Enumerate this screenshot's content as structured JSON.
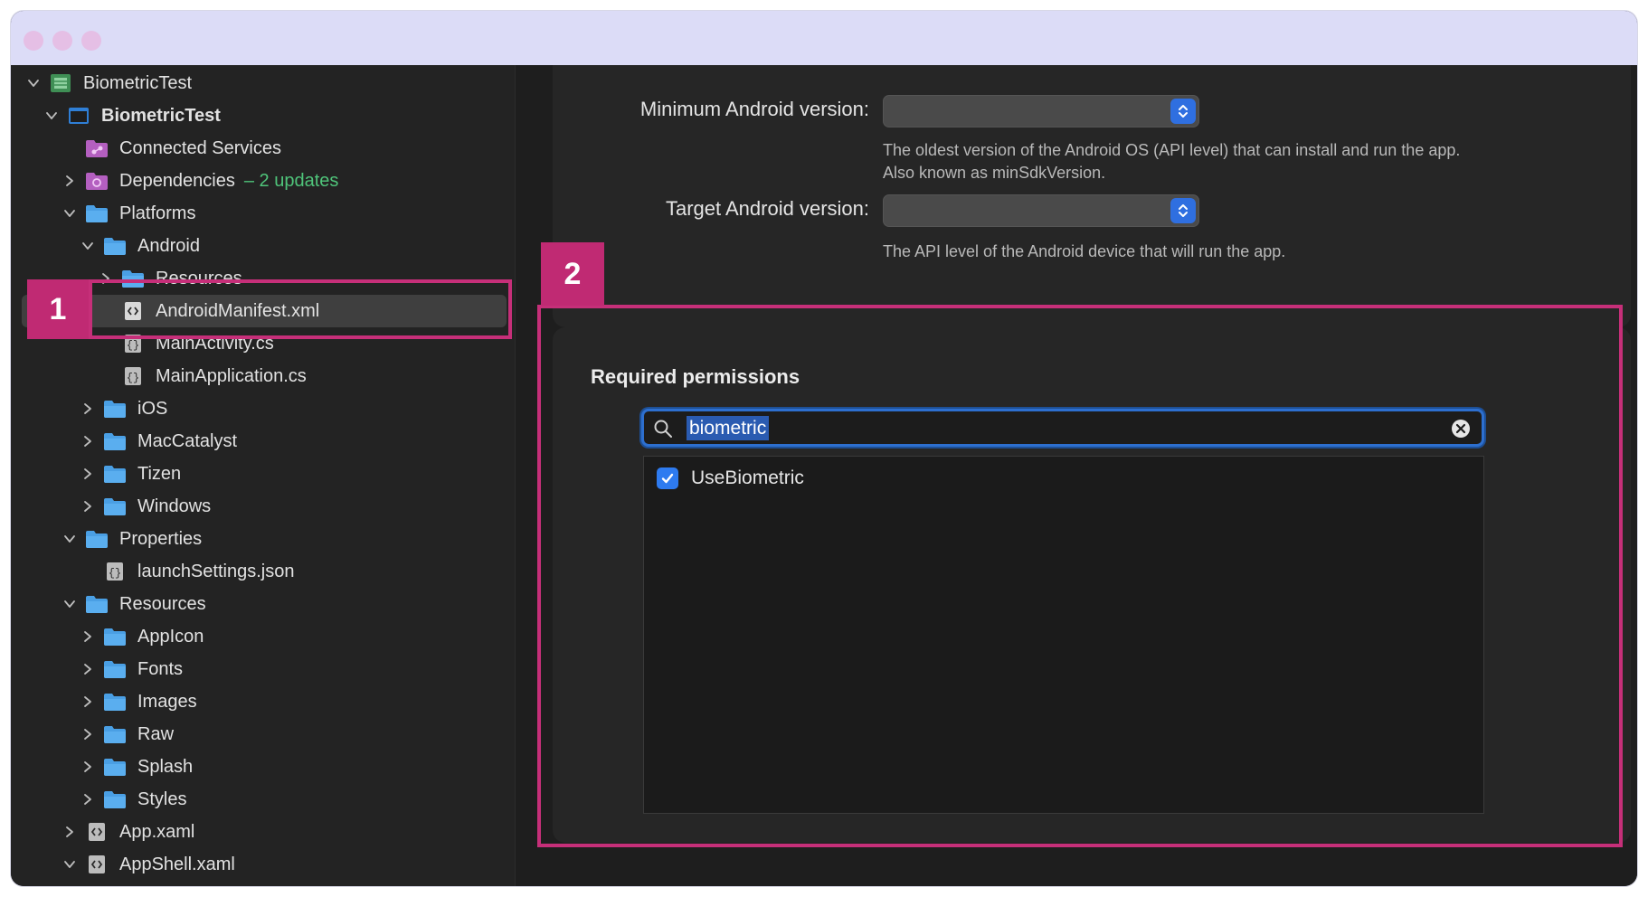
{
  "tree": [
    {
      "label": "BiometricTest",
      "depth": 0,
      "chevron": "down",
      "icon": "solution-icon"
    },
    {
      "label": "BiometricTest",
      "depth": 1,
      "chevron": "down",
      "icon": "project-icon",
      "bold": true
    },
    {
      "label": "Connected Services",
      "depth": 2,
      "chevron": "none",
      "icon": "connected-services-icon"
    },
    {
      "label": "Dependencies",
      "depth": 2,
      "chevron": "right",
      "icon": "dependencies-icon",
      "badge": "– 2 updates"
    },
    {
      "label": "Platforms",
      "depth": 2,
      "chevron": "down",
      "icon": "folder-icon"
    },
    {
      "label": "Android",
      "depth": 3,
      "chevron": "down",
      "icon": "folder-icon"
    },
    {
      "label": "Resources",
      "depth": 4,
      "chevron": "right",
      "icon": "folder-icon"
    },
    {
      "label": "AndroidManifest.xml",
      "depth": 4,
      "chevron": "none",
      "icon": "xml-file-icon",
      "selected": true
    },
    {
      "label": "MainActivity.cs",
      "depth": 4,
      "chevron": "none",
      "icon": "csharp-file-icon"
    },
    {
      "label": "MainApplication.cs",
      "depth": 4,
      "chevron": "none",
      "icon": "csharp-file-icon"
    },
    {
      "label": "iOS",
      "depth": 3,
      "chevron": "right",
      "icon": "folder-icon"
    },
    {
      "label": "MacCatalyst",
      "depth": 3,
      "chevron": "right",
      "icon": "folder-icon"
    },
    {
      "label": "Tizen",
      "depth": 3,
      "chevron": "right",
      "icon": "folder-icon"
    },
    {
      "label": "Windows",
      "depth": 3,
      "chevron": "right",
      "icon": "folder-icon"
    },
    {
      "label": "Properties",
      "depth": 2,
      "chevron": "down",
      "icon": "folder-icon"
    },
    {
      "label": "launchSettings.json",
      "depth": 3,
      "chevron": "none",
      "icon": "json-file-icon"
    },
    {
      "label": "Resources",
      "depth": 2,
      "chevron": "down",
      "icon": "folder-icon"
    },
    {
      "label": "AppIcon",
      "depth": 3,
      "chevron": "right",
      "icon": "folder-icon"
    },
    {
      "label": "Fonts",
      "depth": 3,
      "chevron": "right",
      "icon": "folder-icon"
    },
    {
      "label": "Images",
      "depth": 3,
      "chevron": "right",
      "icon": "folder-icon"
    },
    {
      "label": "Raw",
      "depth": 3,
      "chevron": "right",
      "icon": "folder-icon"
    },
    {
      "label": "Splash",
      "depth": 3,
      "chevron": "right",
      "icon": "folder-icon"
    },
    {
      "label": "Styles",
      "depth": 3,
      "chevron": "right",
      "icon": "folder-icon"
    },
    {
      "label": "App.xaml",
      "depth": 2,
      "chevron": "right",
      "icon": "xaml-file-icon"
    },
    {
      "label": "AppShell.xaml",
      "depth": 2,
      "chevron": "down",
      "icon": "xaml-file-icon"
    }
  ],
  "settings": {
    "min_version": {
      "label": "Minimum Android version:",
      "help": "The oldest version of the Android OS (API level) that can install and run the app. Also known as minSdkVersion."
    },
    "target_version": {
      "label": "Target Android version:",
      "help": "The API level of the Android device that will run the app."
    }
  },
  "permissions": {
    "title": "Required permissions",
    "search_query": "biometric",
    "items": [
      {
        "label": "UseBiometric",
        "checked": true
      }
    ]
  },
  "callouts": {
    "one": "1",
    "two": "2"
  },
  "colors": {
    "accent": "#2e7bf0",
    "callout": "#c62f79",
    "badge_green": "#4fc47a",
    "folder_blue": "#4a9fe4",
    "titlebar": "#dcdcf7"
  }
}
